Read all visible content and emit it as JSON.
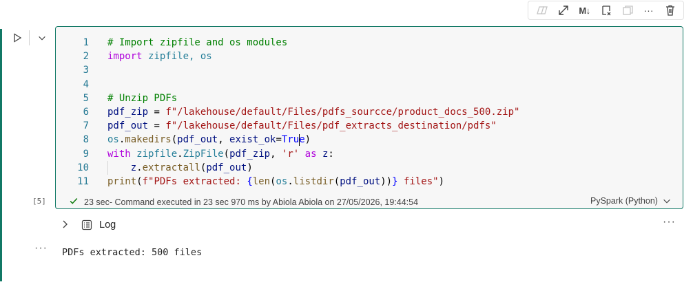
{
  "toolbar": {
    "markdown_label": "M↓",
    "more_label": "···"
  },
  "cell": {
    "execution_count": "[5]",
    "code_lines": [
      {
        "n": "1"
      },
      {
        "n": "2"
      },
      {
        "n": "3"
      },
      {
        "n": "4"
      },
      {
        "n": "5"
      },
      {
        "n": "6"
      },
      {
        "n": "7"
      },
      {
        "n": "8"
      },
      {
        "n": "9"
      },
      {
        "n": "10"
      },
      {
        "n": "11"
      }
    ],
    "tokens": {
      "l1": "# Import zipfile and os modules",
      "l2_kw": "import",
      "l2_mods": "zipfile, os",
      "l5": "# Unzip PDFs",
      "l6_var": "pdf_zip",
      "l6_str": "f\"/lakehouse/default/Files/pdfs_sourcce/product_docs_500.zip\"",
      "l7_var": "pdf_out",
      "l7_str": "f\"/lakehouse/default/Files/pdf_extracts_destination/pdfs\"",
      "l8_os": "os",
      "l8_fn": "makedirs",
      "l8_arg1": "pdf_out",
      "l8_kwarg": "exist_ok",
      "l8_val_a": "Tru",
      "l8_val_b": "e",
      "l9_kw": "with",
      "l9_mod": "zipfile",
      "l9_cls": "ZipFile",
      "l9_arg": "pdf_zip",
      "l9_str": "'r'",
      "l9_as": "as",
      "l9_z": "z",
      "l10_z": "z",
      "l10_fn": "extractall",
      "l10_arg": "pdf_out",
      "l11_fn": "print",
      "l11_str_a": "f\"PDFs extracted: ",
      "l11_len": "len",
      "l11_os": "os",
      "l11_listdir": "listdir",
      "l11_arg": "pdf_out",
      "l11_str_b": " files\""
    },
    "status_time": "23 sec",
    "status_text": " - Command executed in 23 sec 970 ms by Abiola Abiola on 27/05/2026, 19:44:54",
    "language": "PySpark (Python)"
  },
  "log": {
    "label": "Log",
    "more_label": "···"
  },
  "output": {
    "more_label": "···",
    "text": "PDFs extracted: 500 files"
  },
  "colors": {
    "accent": "#117865",
    "success": "#107c10"
  }
}
